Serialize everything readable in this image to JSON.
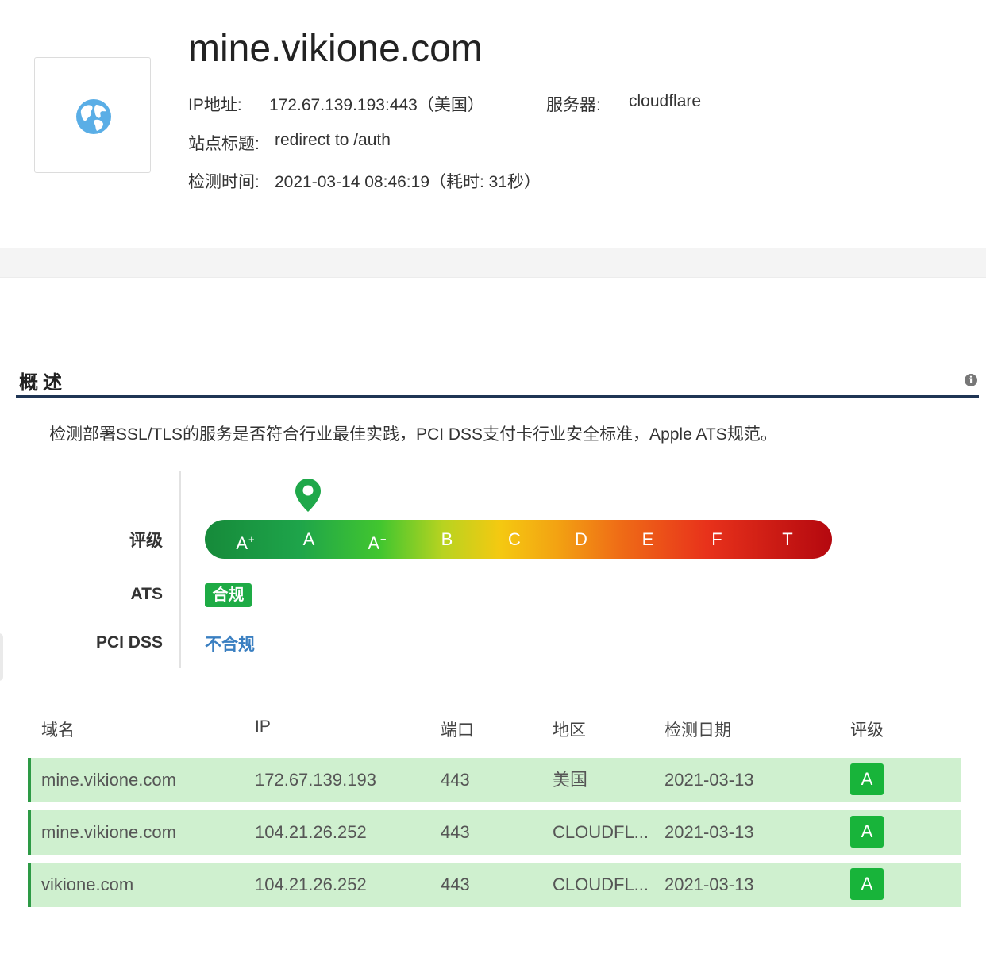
{
  "header": {
    "domain": "mine.vikione.com",
    "ip_label": "IP地址:",
    "ip_value": "172.67.139.193:443（美国）",
    "server_label": "服务器:",
    "server_value": "cloudflare",
    "site_title_label": "站点标题:",
    "site_title_value": "redirect to /auth",
    "check_time_label": "检测时间:",
    "check_time_value": "2021-03-14 08:46:19（耗时: 31秒）",
    "icon": "globe-icon"
  },
  "overview": {
    "title": "概述",
    "info_icon": "info-icon",
    "description": "检测部署SSL/TLS的服务是否符合行业最佳实践，PCI DSS支付卡行业安全标准，Apple ATS规范。",
    "rating_label": "评级",
    "grades": [
      {
        "base": "A",
        "sup": "+"
      },
      {
        "base": "A",
        "sup": ""
      },
      {
        "base": "A",
        "sup": "−"
      },
      {
        "base": "B",
        "sup": ""
      },
      {
        "base": "C",
        "sup": ""
      },
      {
        "base": "D",
        "sup": ""
      },
      {
        "base": "E",
        "sup": ""
      },
      {
        "base": "F",
        "sup": ""
      },
      {
        "base": "T",
        "sup": ""
      }
    ],
    "selected_grade_index": 1,
    "ats_label": "ATS",
    "ats_value": "合规",
    "pci_label": "PCI DSS",
    "pci_value": "不合规",
    "colors": {
      "section_line": "#1f3554",
      "ats_badge": "#1eab45",
      "pci_text": "#3a7fc1",
      "row_bg": "#cff0cf",
      "row_accent": "#2d9a45",
      "grade_badge": "#18b43a",
      "pin": "#1fa84a"
    }
  },
  "table": {
    "headers": [
      "域名",
      "IP",
      "端口",
      "地区",
      "检测日期",
      "评级"
    ],
    "rows": [
      [
        "mine.vikione.com",
        "172.67.139.193",
        "443",
        "美国",
        "2021-03-13",
        "A"
      ],
      [
        "mine.vikione.com",
        "104.21.26.252",
        "443",
        "CLOUDFL...",
        "2021-03-13",
        "A"
      ],
      [
        "vikione.com",
        "104.21.26.252",
        "443",
        "CLOUDFL...",
        "2021-03-13",
        "A"
      ]
    ]
  }
}
